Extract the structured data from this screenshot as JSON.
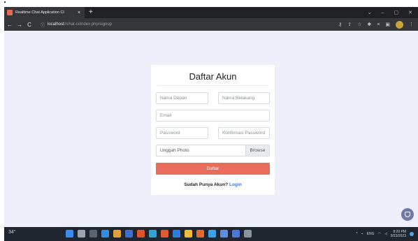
{
  "browser": {
    "tab_title": "Realtime Chat Application Cl",
    "tab_close": "×",
    "new_tab": "+",
    "window_controls": [
      "⌄",
      "–",
      "▢",
      "✕"
    ],
    "nav": {
      "back": "←",
      "forward": "→",
      "reload": "C"
    },
    "address": {
      "host": "localhost",
      "path": "/rchat-ci/index.php/signup"
    },
    "toolbar_icons": [
      "key-icon",
      "share-icon",
      "star-icon",
      "extensions-icon",
      "media-icon",
      "sidepanel-icon",
      "profile-icon"
    ]
  },
  "form": {
    "title": "Daftar Akun",
    "first_name_placeholder": "Nama Depan",
    "last_name_placeholder": "Nama Belakang",
    "email_placeholder": "Email",
    "password_placeholder": "Password",
    "confirm_password_placeholder": "Konfirmasi Password",
    "photo_label": "Unggah Photo",
    "browse_label": "Browse",
    "submit_label": "Daftar",
    "login_prompt": "Sudah Punya Akun?",
    "login_link": "Login"
  },
  "colors": {
    "page_bg": "#edf0fb",
    "submit_bg": "#e96c5d",
    "link": "#2f7be0",
    "fab": "#6e7ba6"
  },
  "taskbar": {
    "weather": "34°",
    "lang": "ENG",
    "time": "8:20 PM",
    "date": "9/23/2023",
    "apps": [
      "#3d8bf0",
      "#9aa4b0",
      "#5b6470",
      "#2f8de4",
      "#e0a33a",
      "#3b6fd6",
      "#e2532d",
      "#2fa3d8",
      "#e05a33",
      "#2a7de1",
      "#f3b93a",
      "#e66a2c",
      "#3aa0e8",
      "#5c8ee8",
      "#4a78d8",
      "#8a94a0"
    ]
  }
}
